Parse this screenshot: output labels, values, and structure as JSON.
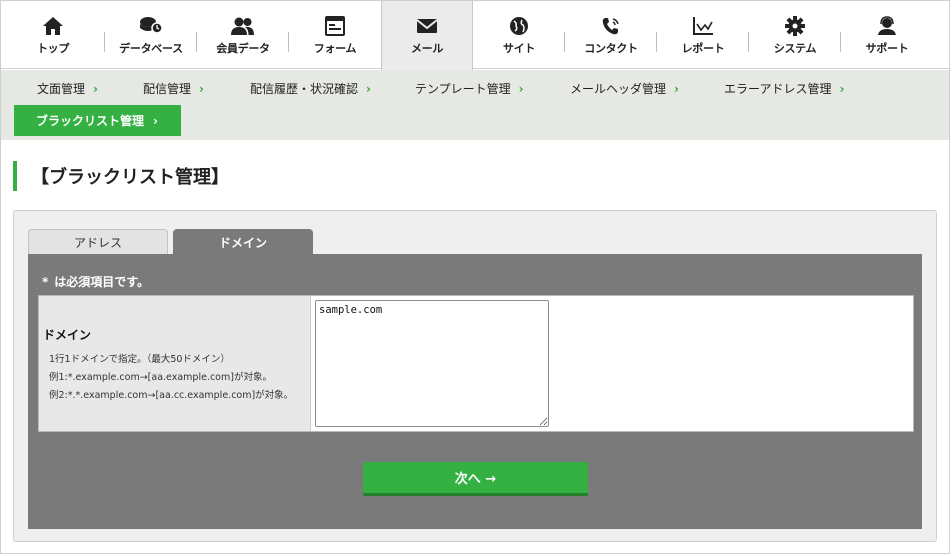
{
  "topnav": {
    "items": [
      {
        "label": "トップ",
        "icon": "home-icon"
      },
      {
        "label": "データベース",
        "icon": "database-icon"
      },
      {
        "label": "会員データ",
        "icon": "users-icon"
      },
      {
        "label": "フォーム",
        "icon": "form-icon"
      },
      {
        "label": "メール",
        "icon": "mail-icon",
        "active": true
      },
      {
        "label": "サイト",
        "icon": "globe-icon"
      },
      {
        "label": "コンタクト",
        "icon": "phone-icon"
      },
      {
        "label": "レポート",
        "icon": "chart-icon"
      },
      {
        "label": "システム",
        "icon": "gear-icon"
      },
      {
        "label": "サポート",
        "icon": "support-icon"
      }
    ]
  },
  "subnav": {
    "items": [
      {
        "label": "文面管理"
      },
      {
        "label": "配信管理"
      },
      {
        "label": "配信履歴・状況確認"
      },
      {
        "label": "テンプレート管理"
      },
      {
        "label": "メールヘッダ管理"
      },
      {
        "label": "エラーアドレス管理"
      }
    ],
    "active": {
      "label": "ブラックリスト管理"
    },
    "chevron": "›"
  },
  "page": {
    "title": "【ブラックリスト管理】"
  },
  "tabs": {
    "address": "アドレス",
    "domain": "ドメイン"
  },
  "form": {
    "required_star": "*",
    "required_note": "は必須項目です。",
    "field": {
      "label": "ドメイン",
      "hint1": "1行1ドメインで指定。（最大50ドメイン）",
      "hint2": "例1:*.example.com→[aa.example.com]が対象。",
      "hint3": "例2:*.*.example.com→[aa.cc.example.com]が対象。",
      "value": "sample.com"
    },
    "next_label": "次へ →"
  },
  "colors": {
    "accent": "#35b043",
    "form_bg": "#7a7a7a",
    "subnav_bg": "#e6e8e4"
  }
}
